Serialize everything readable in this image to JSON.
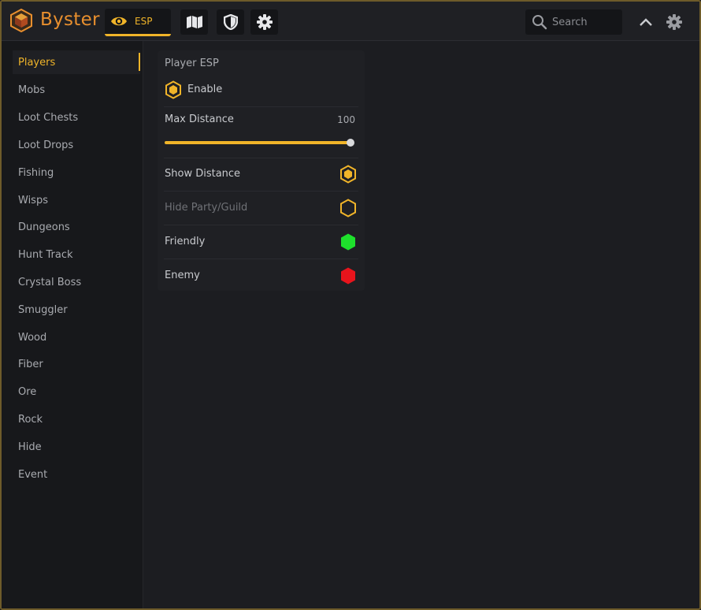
{
  "app": {
    "title": "Byster"
  },
  "tabs": [
    {
      "label": "ESP",
      "icon": "eye-icon",
      "active": true
    },
    {
      "label": "",
      "icon": "map-icon",
      "active": false
    },
    {
      "label": "",
      "icon": "shield-icon",
      "active": false
    },
    {
      "label": "",
      "icon": "gear-icon",
      "active": false
    }
  ],
  "search": {
    "placeholder": "Search"
  },
  "sidebar": {
    "items": [
      {
        "label": "Players",
        "active": true
      },
      {
        "label": "Mobs"
      },
      {
        "label": "Loot Chests"
      },
      {
        "label": "Loot Drops"
      },
      {
        "label": "Fishing"
      },
      {
        "label": "Wisps"
      },
      {
        "label": "Dungeons"
      },
      {
        "label": "Hunt Track"
      },
      {
        "label": "Crystal Boss"
      },
      {
        "label": "Smuggler"
      },
      {
        "label": "Wood"
      },
      {
        "label": "Fiber"
      },
      {
        "label": "Ore"
      },
      {
        "label": "Rock"
      },
      {
        "label": "Hide"
      },
      {
        "label": "Event"
      }
    ]
  },
  "panel": {
    "title": "Player ESP",
    "enable": {
      "label": "Enable",
      "checked": true
    },
    "max_distance": {
      "label": "Max Distance",
      "value": "100",
      "fraction": 1.0
    },
    "toggles": [
      {
        "label": "Show Distance",
        "state": "checked",
        "color": "#f0b429"
      },
      {
        "label": "Hide Party/Guild",
        "state": "unchecked",
        "color": "#f0b429",
        "dim": true
      },
      {
        "label": "Friendly",
        "state": "color",
        "color": "#1ee02c"
      },
      {
        "label": "Enemy",
        "state": "color",
        "color": "#e8141c"
      }
    ]
  },
  "colors": {
    "accent": "#f0b429",
    "brand": "#e88f2e",
    "background": "#1c1d21",
    "sidebar": "#17181b"
  }
}
